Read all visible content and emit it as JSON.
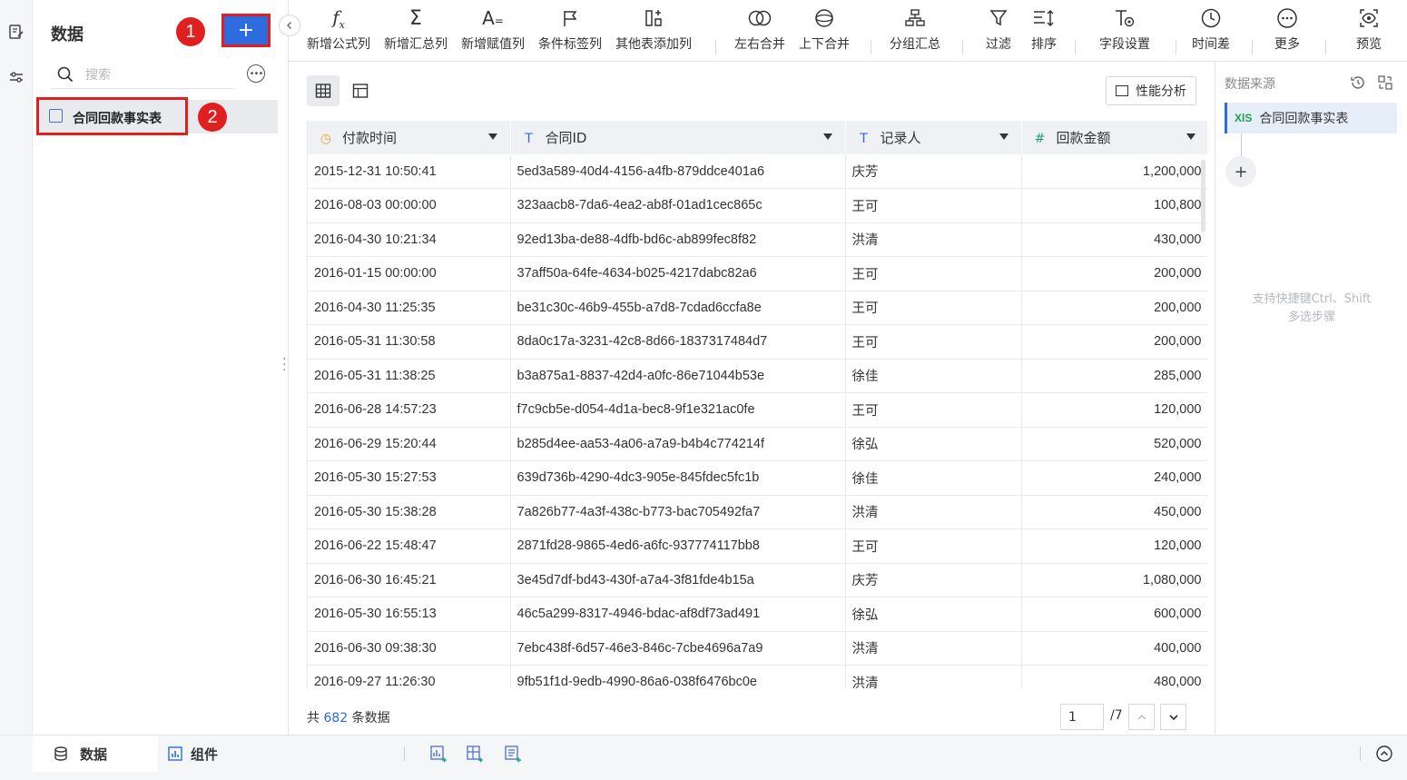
{
  "left_panel": {
    "title": "数据",
    "add_label": "+",
    "badge1": "1",
    "badge2": "2",
    "search_placeholder": "搜索",
    "table_item": "合同回款事实表"
  },
  "toolbar": {
    "items": [
      {
        "label": "新增公式列",
        "icon": "fx-icon"
      },
      {
        "label": "新增汇总列",
        "icon": "sigma-icon"
      },
      {
        "label": "新增赋值列",
        "icon": "assign-icon"
      },
      {
        "label": "条件标签列",
        "icon": "flag-icon"
      },
      {
        "label": "其他表添加列",
        "icon": "add-column-icon"
      },
      {
        "label": "左右合并",
        "icon": "merge-horizontal-icon"
      },
      {
        "label": "上下合并",
        "icon": "merge-vertical-icon"
      },
      {
        "label": "分组汇总",
        "icon": "group-icon"
      },
      {
        "label": "过滤",
        "icon": "filter-icon"
      },
      {
        "label": "排序",
        "icon": "sort-icon"
      },
      {
        "label": "字段设置",
        "icon": "field-settings-icon"
      },
      {
        "label": "时间差",
        "icon": "clock-icon"
      },
      {
        "label": "更多",
        "icon": "more-icon"
      },
      {
        "label": "预览",
        "icon": "preview-icon"
      }
    ]
  },
  "main": {
    "perf_button": "性能分析",
    "columns": [
      {
        "name": "付款时间",
        "type_icon": "clock-icon",
        "type_glyph": "◷",
        "color": "#f0a030"
      },
      {
        "name": "合同ID",
        "type_icon": "text-type-icon",
        "type_glyph": "T",
        "color": "#2d6cdf"
      },
      {
        "name": "记录人",
        "type_icon": "text-type-icon",
        "type_glyph": "T",
        "color": "#2d6cdf"
      },
      {
        "name": "回款金额",
        "type_icon": "number-type-icon",
        "type_glyph": "#",
        "color": "#1fa67a"
      }
    ],
    "rows": [
      [
        "2015-12-31 10:50:41",
        "5ed3a589-40d4-4156-a4fb-879ddce401a6",
        "庆芳",
        "1,200,000"
      ],
      [
        "2016-08-03 00:00:00",
        "323aacb8-7da6-4ea2-ab8f-01ad1cec865c",
        "王可",
        "100,800"
      ],
      [
        "2016-04-30 10:21:34",
        "92ed13ba-de88-4dfb-bd6c-ab899fec8f82",
        "洪清",
        "430,000"
      ],
      [
        "2016-01-15 00:00:00",
        "37aff50a-64fe-4634-b025-4217dabc82a6",
        "王可",
        "200,000"
      ],
      [
        "2016-04-30 11:25:35",
        "be31c30c-46b9-455b-a7d8-7cdad6ccfa8e",
        "王可",
        "200,000"
      ],
      [
        "2016-05-31 11:30:58",
        "8da0c17a-3231-42c8-8d66-1837317484d7",
        "王可",
        "200,000"
      ],
      [
        "2016-05-31 11:38:25",
        "b3a875a1-8837-42d4-a0fc-86e71044b53e",
        "徐佳",
        "285,000"
      ],
      [
        "2016-06-28 14:57:23",
        "f7c9cb5e-d054-4d1a-bec8-9f1e321ac0fe",
        "王可",
        "120,000"
      ],
      [
        "2016-06-29 15:20:44",
        "b285d4ee-aa53-4a06-a7a9-b4b4c774214f",
        "徐弘",
        "520,000"
      ],
      [
        "2016-05-30 15:27:53",
        "639d736b-4290-4dc3-905e-845fdec5fc1b",
        "徐佳",
        "240,000"
      ],
      [
        "2016-05-30 15:38:28",
        "7a826b77-4a3f-438c-b773-bac705492fa7",
        "洪清",
        "450,000"
      ],
      [
        "2016-06-22 15:48:47",
        "2871fd28-9865-4ed6-a6fc-937774117bb8",
        "王可",
        "120,000"
      ],
      [
        "2016-06-30 16:45:21",
        "3e45d7df-bd43-430f-a7a4-3f81fde4b15a",
        "庆芳",
        "1,080,000"
      ],
      [
        "2016-05-30 16:55:13",
        "46c5a299-8317-4946-bdac-af8df73ad491",
        "徐弘",
        "600,000"
      ],
      [
        "2016-06-30 09:38:30",
        "7ebc438f-6d57-46e3-846c-7cbe4696a7a9",
        "洪清",
        "400,000"
      ],
      [
        "2016-09-27 11:26:30",
        "9fb51f1d-9edb-4990-86a6-038f6476bc0e",
        "洪清",
        "480,000"
      ]
    ],
    "footer": {
      "prefix": "共",
      "count": "682",
      "suffix": "条数据",
      "page": "1",
      "total": "/7"
    }
  },
  "right_panel": {
    "title": "数据来源",
    "source_badge": "XlS",
    "source_name": "合同回款事实表",
    "add_label": "+",
    "hint_line1": "支持快捷键Ctrl、Shift",
    "hint_line2": "多选步骤"
  },
  "bottom_bar": {
    "tab_data": "数据",
    "tab_components": "组件"
  },
  "colors": {
    "accent": "#2d6cdf",
    "badge": "#e02020"
  }
}
